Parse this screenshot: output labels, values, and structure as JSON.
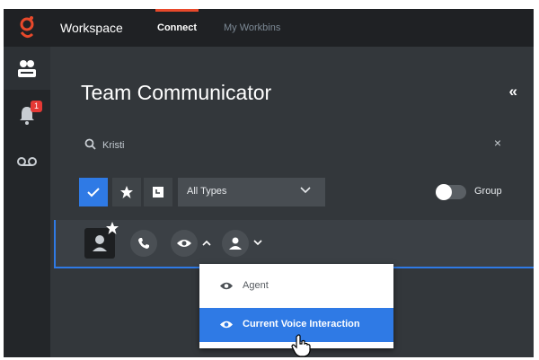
{
  "header": {
    "app_title": "Workspace",
    "tabs": [
      {
        "label": "Connect",
        "active": true
      },
      {
        "label": "My Workbins",
        "active": false
      }
    ],
    "accent_color": "#e8492b"
  },
  "nav": {
    "items": [
      {
        "icon": "team-communicator-icon",
        "active": true
      },
      {
        "icon": "bell-icon",
        "badge": "1"
      },
      {
        "icon": "voicemail-icon"
      }
    ]
  },
  "panel": {
    "title": "Team Communicator",
    "collapse_glyph": "«",
    "search": {
      "value": "Kristi",
      "clear_glyph": "×"
    },
    "filters": {
      "type_select": "All Types",
      "group_toggle_label": "Group",
      "group_toggle_on": false
    }
  },
  "dropdown": {
    "items": [
      {
        "label": "Agent",
        "icon": "eye-icon",
        "highlighted": false
      },
      {
        "label": "Current Voice Interaction",
        "icon": "eye-icon",
        "highlighted": true
      }
    ],
    "highlight_color": "#2f7ae5"
  }
}
